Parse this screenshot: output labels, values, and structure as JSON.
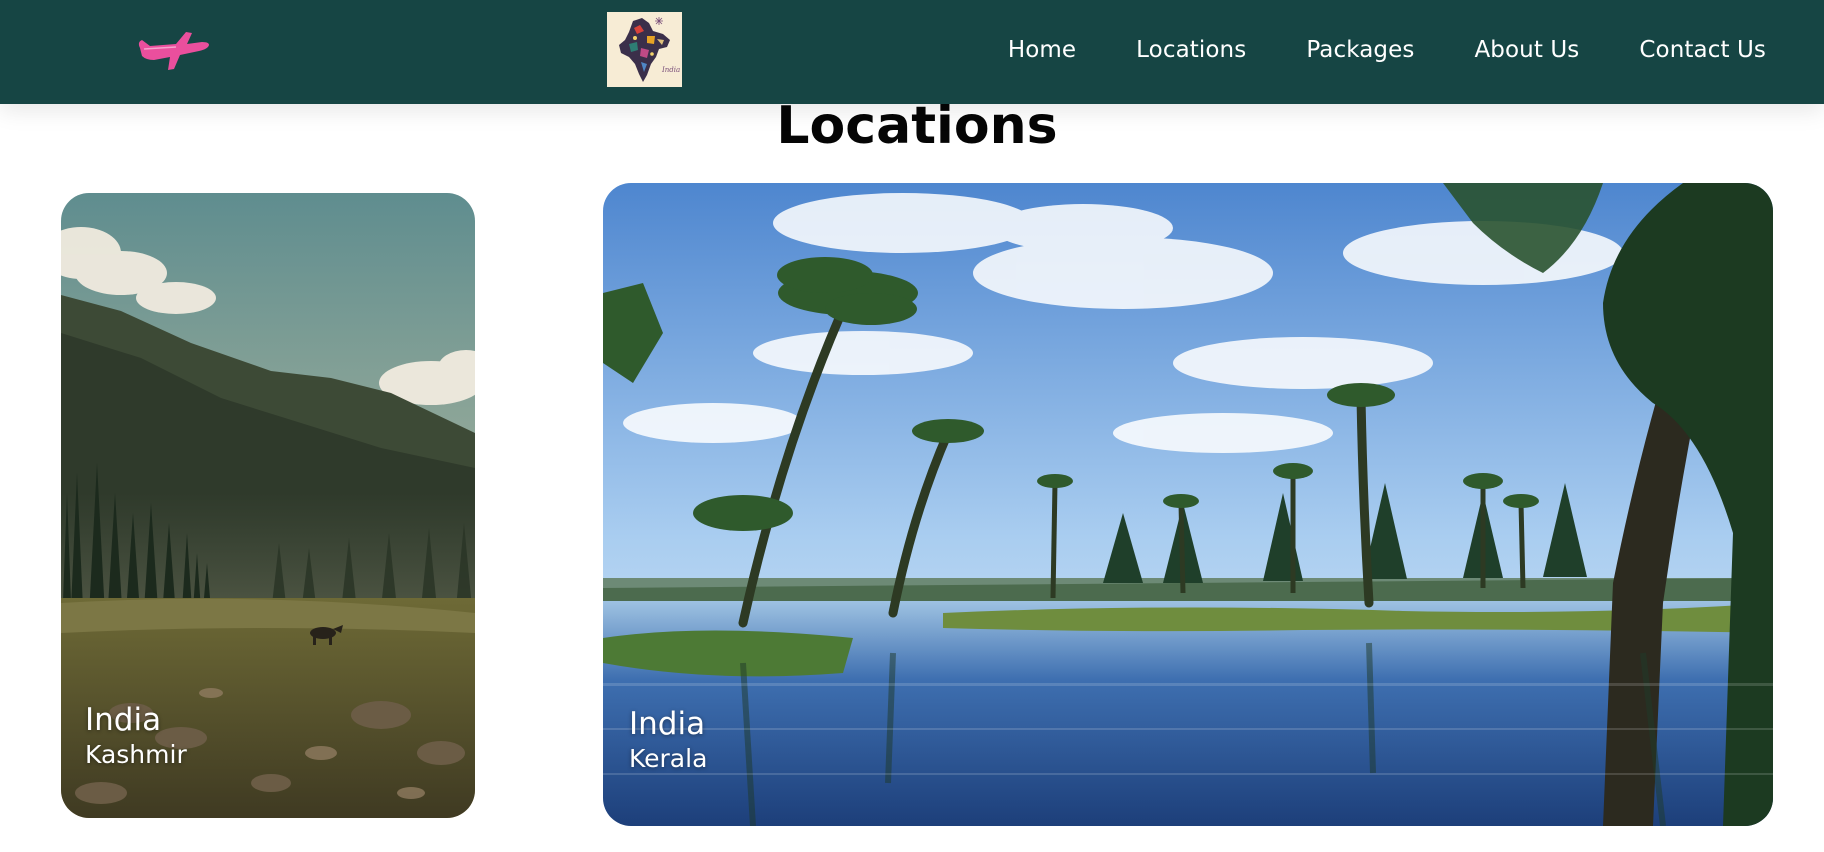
{
  "header": {
    "brand_icon": "airplane-icon",
    "logo_image": "india-map-collage-logo",
    "logo_caption": "India",
    "nav": [
      {
        "label": "Home"
      },
      {
        "label": "Locations"
      },
      {
        "label": "Packages"
      },
      {
        "label": "About Us"
      },
      {
        "label": "Contact Us"
      }
    ]
  },
  "main": {
    "title": "Locations",
    "cards": [
      {
        "country": "India",
        "region": "Kashmir",
        "image": "kashmir-valley-photo"
      },
      {
        "country": "India",
        "region": "Kerala",
        "image": "kerala-backwaters-photo"
      }
    ]
  },
  "colors": {
    "navbar": "#164544",
    "plane": "#ea4f9d",
    "title_text": "#050505",
    "nav_text": "#ffffff"
  }
}
